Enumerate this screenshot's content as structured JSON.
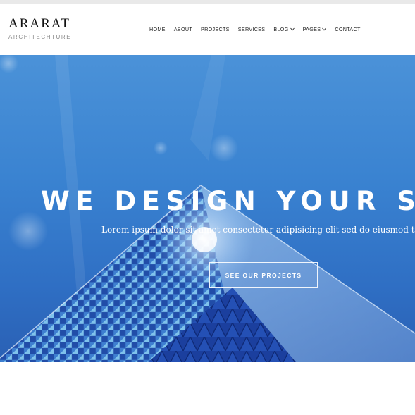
{
  "brand": {
    "name": "ARARAT",
    "tagline": "ARCHITECHTURE"
  },
  "nav": {
    "items": [
      {
        "label": "HOME"
      },
      {
        "label": "ABOUT"
      },
      {
        "label": "PROJECTS"
      },
      {
        "label": "SERVICES"
      },
      {
        "label": "BLOG"
      },
      {
        "label": "PAGES"
      },
      {
        "label": "CONTACT"
      }
    ]
  },
  "hero": {
    "headline": "WE DESIGN YOUR SPA",
    "subtext": "Lorem ipsum dolor sit amet consectetur adipisicing elit sed do eiusmod temp",
    "cta_label": "SEE OUR PROJECTS"
  },
  "colors": {
    "sky": "#3a83d1",
    "building_dark": "#1c3f9a",
    "text_white": "#ffffff"
  },
  "icons": {
    "blog_dropdown": "chevron-down-icon",
    "pages_dropdown": "chevron-down-icon"
  }
}
